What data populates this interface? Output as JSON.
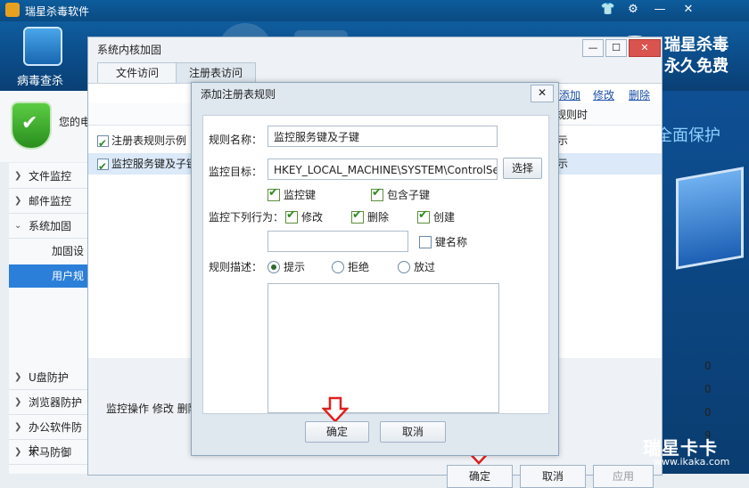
{
  "app": {
    "title": "瑞星杀毒软件"
  },
  "titlebar": {
    "icons": [
      "shirt-icon",
      "gear-icon",
      "minimize-icon",
      "close-icon"
    ]
  },
  "banner": {
    "scan_label": "病毒查杀",
    "brand_line1": "瑞星杀毒",
    "brand_line2": "永久免费"
  },
  "status": {
    "text": "您的电"
  },
  "sidebar": {
    "items": [
      {
        "label": "文件监控"
      },
      {
        "label": "邮件监控"
      },
      {
        "label": "系统加固"
      },
      {
        "label": "U盘防护"
      },
      {
        "label": "浏览器防护"
      },
      {
        "label": "办公软件防护"
      },
      {
        "label": "木马防御"
      }
    ],
    "sub_items": [
      {
        "label": "加固设"
      },
      {
        "label": "用户规"
      }
    ]
  },
  "right_art": {
    "text": "全面保护"
  },
  "watermark": {
    "big": "瑞星卡卡",
    "url": "www.ikaka.com"
  },
  "mid_dialog": {
    "title": "系统内核加固",
    "tabs": [
      {
        "label": "文件访问"
      },
      {
        "label": "注册表访问"
      }
    ],
    "links": {
      "add": "添加",
      "edit": "修改",
      "delete": "删除"
    },
    "column": "规则时",
    "rules": [
      {
        "name": "注册表规则示例",
        "action": "示"
      },
      {
        "name": "监控服务键及子键",
        "action": "示"
      }
    ],
    "counts": [
      "0",
      "0",
      "0",
      "9"
    ],
    "bottom_text": "监控操作 修改 删除",
    "buttons": {
      "ok": "确定",
      "cancel": "取消",
      "apply": "应用"
    }
  },
  "dialog": {
    "title": "添加注册表规则",
    "rule_name_label": "规则名称：",
    "rule_name_value": "监控服务键及子键",
    "target_label": "监控目标：",
    "target_value": "HKEY_LOCAL_MACHINE\\SYSTEM\\ControlSet001\\Se",
    "browse_button": "选择",
    "check_key": "监控键",
    "check_subkeys": "包含子键",
    "behavior_label": "监控下列行为：",
    "behaviors": {
      "modify": "修改",
      "delete": "删除",
      "create": "创建"
    },
    "key_name_label": "键名称",
    "desc_label": "规则描述：",
    "options": {
      "prompt": "提示",
      "deny": "拒绝",
      "allow": "放过"
    },
    "ok_button": "确定",
    "cancel_button": "取消"
  },
  "colors": {
    "accent": "#0b4a86",
    "check_green": "#2f8c1d",
    "arrow_red": "#e02020"
  }
}
